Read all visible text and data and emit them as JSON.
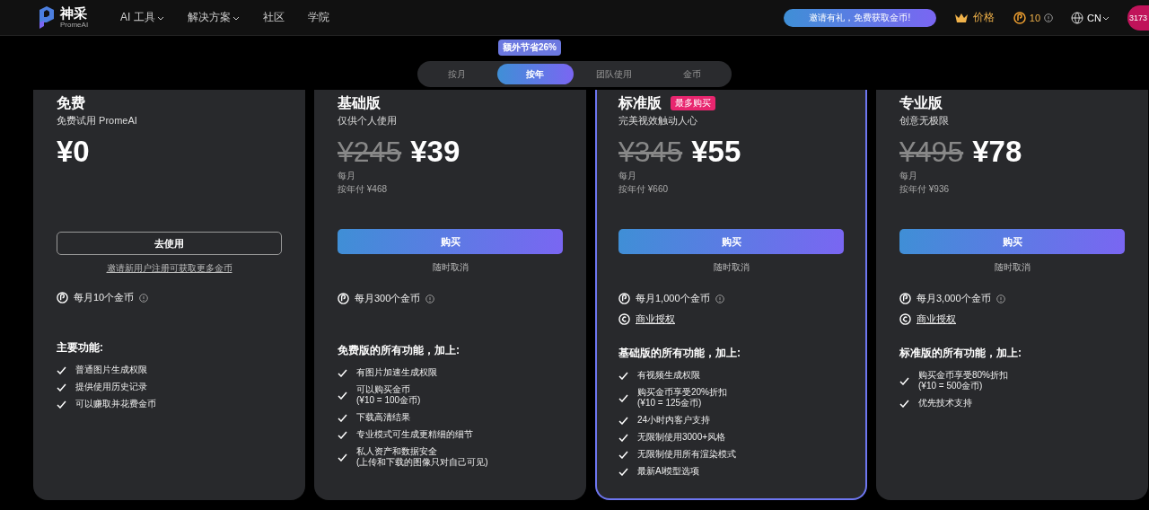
{
  "header": {
    "brand": "神采",
    "brand_sub": "PromeAI",
    "nav": [
      {
        "label": "AI 工具",
        "dropdown": true
      },
      {
        "label": "解决方案",
        "dropdown": true
      },
      {
        "label": "社区",
        "dropdown": false
      },
      {
        "label": "学院",
        "dropdown": false
      }
    ],
    "invite_button": "邀请有礼，免费获取金币!",
    "pricing_link": "价格",
    "coins": "10",
    "language": "CN",
    "avatar": "3173"
  },
  "discount_badge": "额外节省26%",
  "tabs": [
    {
      "label": "按月",
      "selected": false
    },
    {
      "label": "按年",
      "selected": true
    },
    {
      "label": "团队使用",
      "selected": false
    },
    {
      "label": "金币",
      "selected": false
    }
  ],
  "plans": [
    {
      "name": "免费",
      "subtitle": "免费试用 PromeAI",
      "price": "¥0",
      "selected": false,
      "button": {
        "label": "去使用",
        "kind": "outline"
      },
      "note": {
        "text": "邀请新用户注册可获取更多金币",
        "kind": "link"
      },
      "coins": "每月10个金币",
      "features_title": "主要功能:",
      "features": [
        "普通图片生成权限",
        "提供使用历史记录",
        "可以赚取并花费金币"
      ]
    },
    {
      "name": "基础版",
      "subtitle": "仅供个人使用",
      "original_price": "¥245",
      "price": "¥39",
      "period": "每月",
      "yearly": "按年付 ¥468",
      "selected": false,
      "button": {
        "label": "购买",
        "kind": "gradient"
      },
      "note": {
        "text": "随时取消",
        "kind": "plain"
      },
      "coins": "每月300个金币",
      "features_title": "免费版的所有功能，加上:",
      "features": [
        "有图片加速生成权限",
        "可以购买金币\n(¥10 = 100金币)",
        "下载高清结果",
        "专业模式可生成更精细的细节",
        "私人资产和数据安全\n(上传和下载的图像只对自己可见)"
      ]
    },
    {
      "name": "标准版",
      "badge": "最多购买",
      "subtitle": "完美视效触动人心",
      "original_price": "¥345",
      "price": "¥55",
      "period": "每月",
      "yearly": "按年付 ¥660",
      "selected": true,
      "button": {
        "label": "购买",
        "kind": "gradient"
      },
      "note": {
        "text": "随时取消",
        "kind": "plain"
      },
      "coins": "每月1,000个金币",
      "license": "商业授权",
      "features_title": "基础版的所有功能，加上:",
      "features": [
        "有视频生成权限",
        "购买金币享受20%折扣\n(¥10 = 125金币)",
        "24小时内客户支持",
        "无限制使用3000+风格",
        "无限制使用所有渲染模式",
        "最新AI模型选项"
      ]
    },
    {
      "name": "专业版",
      "subtitle": "创意无极限",
      "original_price": "¥495",
      "price": "¥78",
      "period": "每月",
      "yearly": "按年付 ¥936",
      "selected": false,
      "button": {
        "label": "购买",
        "kind": "gradient"
      },
      "note": {
        "text": "随时取消",
        "kind": "plain"
      },
      "coins": "每月3,000个金币",
      "license": "商业授权",
      "features_title": "标准版的所有功能，加上:",
      "features": [
        "购买金币享受80%折扣\n(¥10 = 500金币)",
        "优先技术支持"
      ]
    }
  ]
}
